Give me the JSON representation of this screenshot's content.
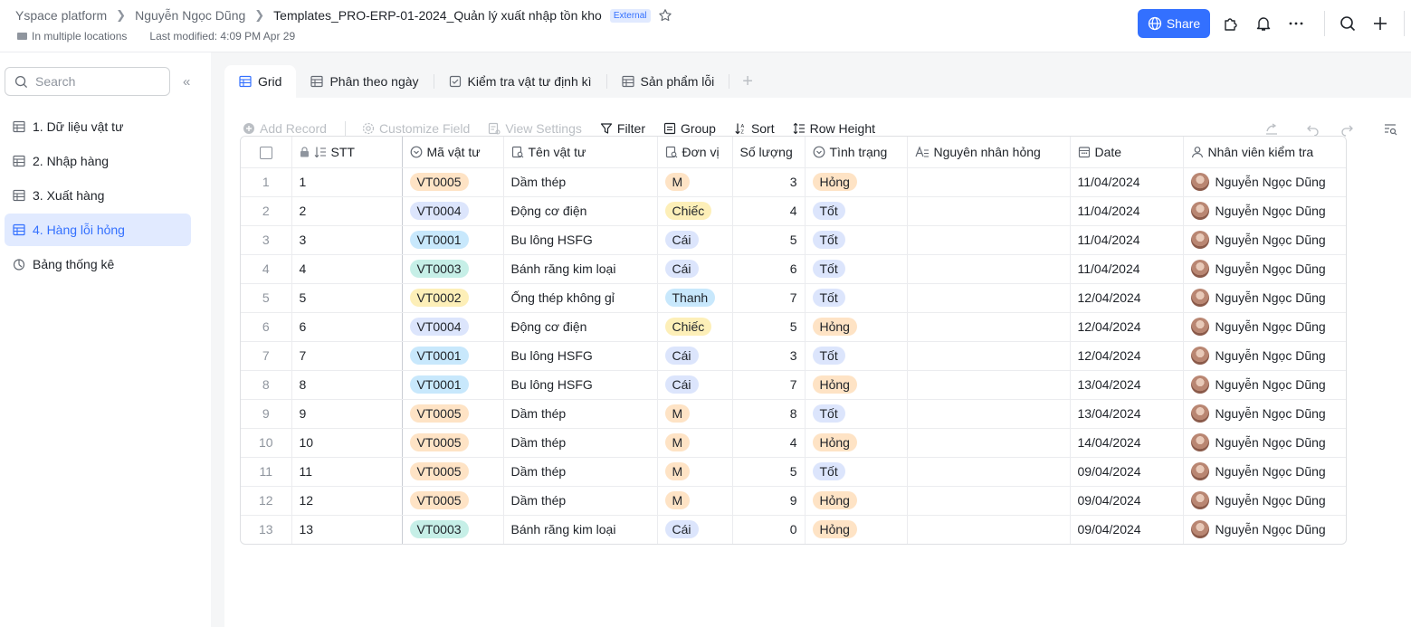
{
  "header": {
    "breadcrumbs": [
      "Yspace platform",
      "Nguyễn Ngọc Dũng",
      "Templates_PRO-ERP-01-2024_Quản lý xuất nhập tồn kho"
    ],
    "external_badge": "External",
    "location": "In multiple locations",
    "last_modified": "Last modified: 4:09 PM Apr 29",
    "share_label": "Share"
  },
  "sidebar": {
    "search_placeholder": "Search",
    "items": [
      {
        "label": "1. Dữ liệu vật tư",
        "icon": "grid-icon"
      },
      {
        "label": "2. Nhập hàng",
        "icon": "grid-icon"
      },
      {
        "label": "3. Xuất hàng",
        "icon": "grid-icon"
      },
      {
        "label": "4. Hàng lỗi hỏng",
        "icon": "grid-icon",
        "active": true
      },
      {
        "label": "Bảng thống kê",
        "icon": "dashboard-icon"
      }
    ]
  },
  "tabs": [
    {
      "label": "Grid",
      "active": true
    },
    {
      "label": "Phân theo ngày"
    },
    {
      "label": "Kiểm tra vật tư định kì"
    },
    {
      "label": "Sản phẩm lỗi"
    }
  ],
  "toolbar": {
    "add_record": "Add Record",
    "customize_field": "Customize Field",
    "view_settings": "View Settings",
    "filter": "Filter",
    "group": "Group",
    "sort": "Sort",
    "row_height": "Row Height"
  },
  "columns": [
    "STT",
    "Mã vật tư",
    "Tên vật tư",
    "Đơn vị",
    "Số lượng",
    "Tình trạng",
    "Nguyên nhân hỏng",
    "Date",
    "Nhân viên kiểm tra"
  ],
  "colors": {
    "accent": "#3370ff",
    "VT0005": "#fee3c5",
    "VT0004": "#dce5fc",
    "VT0001": "#c8e8fc",
    "VT0003": "#c6efe7",
    "VT0002": "#fdefb8",
    "M": "#fee3c5",
    "Chiếc": "#fdefb8",
    "Cái": "#dce5fc",
    "Thanh": "#c8e8fc",
    "Hỏng": "#fee3c5",
    "Tốt": "#dce5fc"
  },
  "rows": [
    {
      "n": "1",
      "stt": "1",
      "code": "VT0005",
      "name": "Dầm thép",
      "unit": "M",
      "qty": "3",
      "status": "Hỏng",
      "reason": "",
      "date": "11/04/2024",
      "staff": "Nguyễn Ngọc Dũng"
    },
    {
      "n": "2",
      "stt": "2",
      "code": "VT0004",
      "name": "Động cơ điện",
      "unit": "Chiếc",
      "qty": "4",
      "status": "Tốt",
      "reason": "",
      "date": "11/04/2024",
      "staff": "Nguyễn Ngọc Dũng"
    },
    {
      "n": "3",
      "stt": "3",
      "code": "VT0001",
      "name": "Bu lông HSFG",
      "unit": "Cái",
      "qty": "5",
      "status": "Tốt",
      "reason": "",
      "date": "11/04/2024",
      "staff": "Nguyễn Ngọc Dũng"
    },
    {
      "n": "4",
      "stt": "4",
      "code": "VT0003",
      "name": "Bánh răng kim loại",
      "unit": "Cái",
      "qty": "6",
      "status": "Tốt",
      "reason": "",
      "date": "11/04/2024",
      "staff": "Nguyễn Ngọc Dũng"
    },
    {
      "n": "5",
      "stt": "5",
      "code": "VT0002",
      "name": "Ống thép không gỉ",
      "unit": "Thanh",
      "qty": "7",
      "status": "Tốt",
      "reason": "",
      "date": "12/04/2024",
      "staff": "Nguyễn Ngọc Dũng"
    },
    {
      "n": "6",
      "stt": "6",
      "code": "VT0004",
      "name": "Động cơ điện",
      "unit": "Chiếc",
      "qty": "5",
      "status": "Hỏng",
      "reason": "",
      "date": "12/04/2024",
      "staff": "Nguyễn Ngọc Dũng"
    },
    {
      "n": "7",
      "stt": "7",
      "code": "VT0001",
      "name": "Bu lông HSFG",
      "unit": "Cái",
      "qty": "3",
      "status": "Tốt",
      "reason": "",
      "date": "12/04/2024",
      "staff": "Nguyễn Ngọc Dũng"
    },
    {
      "n": "8",
      "stt": "8",
      "code": "VT0001",
      "name": "Bu lông HSFG",
      "unit": "Cái",
      "qty": "7",
      "status": "Hỏng",
      "reason": "",
      "date": "13/04/2024",
      "staff": "Nguyễn Ngọc Dũng"
    },
    {
      "n": "9",
      "stt": "9",
      "code": "VT0005",
      "name": "Dầm thép",
      "unit": "M",
      "qty": "8",
      "status": "Tốt",
      "reason": "",
      "date": "13/04/2024",
      "staff": "Nguyễn Ngọc Dũng"
    },
    {
      "n": "10",
      "stt": "10",
      "code": "VT0005",
      "name": "Dầm thép",
      "unit": "M",
      "qty": "4",
      "status": "Hỏng",
      "reason": "",
      "date": "14/04/2024",
      "staff": "Nguyễn Ngọc Dũng"
    },
    {
      "n": "11",
      "stt": "11",
      "code": "VT0005",
      "name": "Dầm thép",
      "unit": "M",
      "qty": "5",
      "status": "Tốt",
      "reason": "",
      "date": "09/04/2024",
      "staff": "Nguyễn Ngọc Dũng"
    },
    {
      "n": "12",
      "stt": "12",
      "code": "VT0005",
      "name": "Dầm thép",
      "unit": "M",
      "qty": "9",
      "status": "Hỏng",
      "reason": "",
      "date": "09/04/2024",
      "staff": "Nguyễn Ngọc Dũng"
    },
    {
      "n": "13",
      "stt": "13",
      "code": "VT0003",
      "name": "Bánh răng kim loại",
      "unit": "Cái",
      "qty": "0",
      "status": "Hỏng",
      "reason": "",
      "date": "09/04/2024",
      "staff": "Nguyễn Ngọc Dũng"
    }
  ]
}
